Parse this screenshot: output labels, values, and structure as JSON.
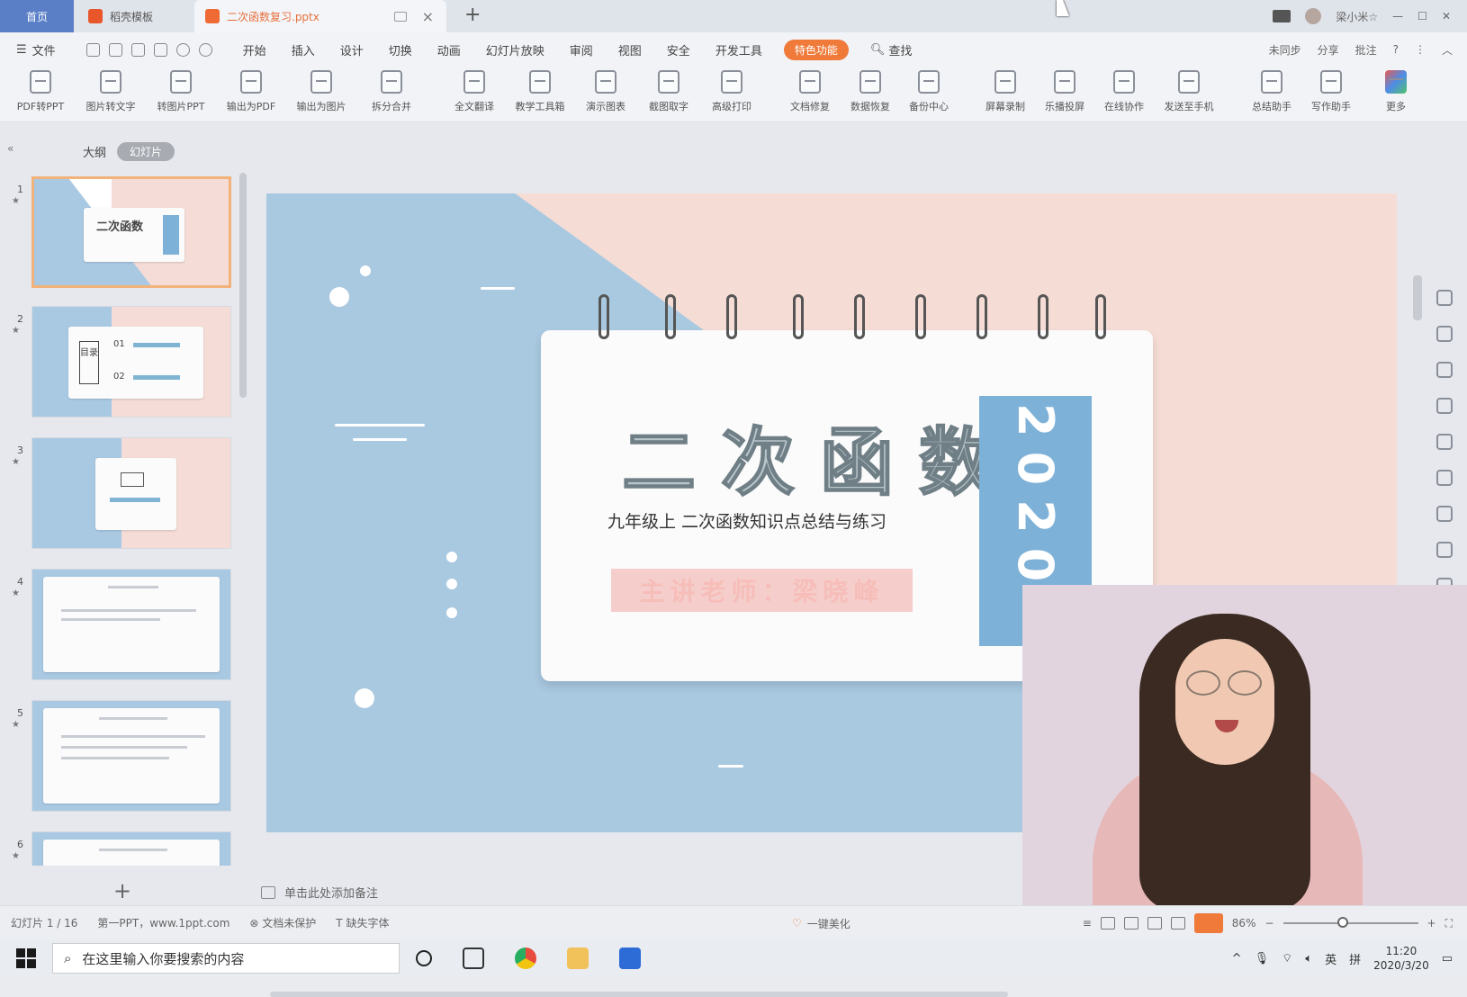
{
  "titlebar": {
    "tabs": [
      "首页",
      "稻壳模板",
      "二次函数复习.pptx"
    ],
    "user": "梁小米☆"
  },
  "menubar": {
    "file": "文件",
    "items": [
      "开始",
      "插入",
      "设计",
      "切换",
      "动画",
      "幻灯片放映",
      "审阅",
      "视图",
      "安全",
      "开发工具"
    ],
    "special": "特色功能",
    "search": "查找",
    "right": [
      "未同步",
      "分享",
      "批注"
    ]
  },
  "toolbar": {
    "items": [
      "PDF转PPT",
      "图片转文字",
      "转图片PPT",
      "输出为PDF",
      "输出为图片",
      "拆分合并",
      "全文翻译",
      "教学工具箱",
      "演示图表",
      "截图取字",
      "高级打印",
      "文档修复",
      "数据恢复",
      "备份中心",
      "屏幕录制",
      "乐播投屏",
      "在线协作",
      "发送至手机",
      "总结助手",
      "写作助手",
      "更多"
    ]
  },
  "panel": {
    "tab_outline": "大纲",
    "tab_slides": "幻灯片",
    "slide_numbers": [
      "1",
      "2",
      "3",
      "4",
      "5",
      "6"
    ],
    "thumb2": {
      "tag": "目录",
      "i1": "01",
      "i2": "02"
    }
  },
  "slide": {
    "title": "二次函数",
    "subtitle": "九年级上 二次函数知识点总结与练习",
    "presenter": "主讲老师：梁晓峰",
    "year": "2020"
  },
  "notes": "单击此处添加备注",
  "status": {
    "slide_count": "幻灯片 1 / 16",
    "theme": "第一PPT，www.1ppt.com",
    "protect": "文档未保护",
    "font": "缺失字体",
    "beautify": "一键美化",
    "zoom": "86%"
  },
  "taskbar": {
    "search_placeholder": "在这里输入你要搜索的内容",
    "ime": "英",
    "ime2": "拼",
    "time": "11:20",
    "date": "2020/3/20"
  }
}
